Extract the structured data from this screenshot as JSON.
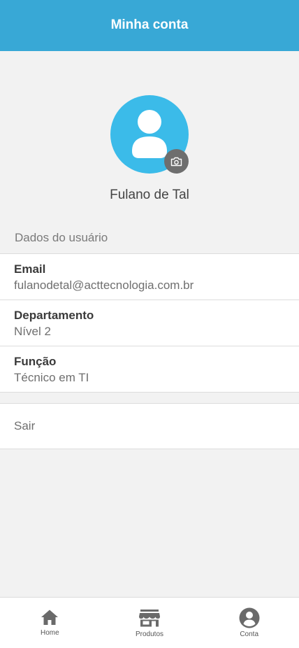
{
  "colors": {
    "accent": "#38a8d6",
    "avatar": "#3bbbe9",
    "background": "#f2f2f2"
  },
  "header": {
    "title": "Minha conta"
  },
  "profile": {
    "name": "Fulano de Tal",
    "avatar_icon": "user-icon",
    "camera_icon": "camera-icon"
  },
  "section": {
    "label": "Dados do usuário"
  },
  "fields": [
    {
      "title": "Email",
      "value": "fulanodetal@acttecnologia.com.br"
    },
    {
      "title": "Departamento",
      "value": "Nível 2"
    },
    {
      "title": "Função",
      "value": "Técnico em TI"
    }
  ],
  "logout": {
    "label": "Sair"
  },
  "nav": {
    "items": [
      {
        "label": "Home",
        "icon": "home-icon"
      },
      {
        "label": "Produtos",
        "icon": "store-icon"
      },
      {
        "label": "Conta",
        "icon": "account-icon"
      }
    ]
  }
}
